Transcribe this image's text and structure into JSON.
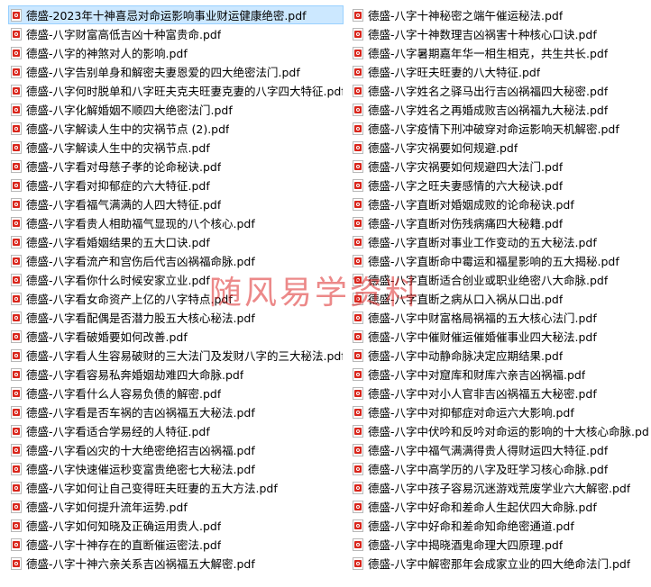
{
  "colors": {
    "pdf_icon": "#d9261c",
    "selection_bg": "#cce8ff",
    "watermark": "#dc2828"
  },
  "watermark": "随风易学资料",
  "files_left": [
    "德盛-2023年十神喜忌对命运影响事业财运健康绝密.pdf",
    "德盛-八字财富高低吉凶十种富贵命.pdf",
    "德盛-八字的神煞对人的影响.pdf",
    "德盛-八字告别单身和解密夫妻恩爱的四大绝密法门.pdf",
    "德盛-八字何时脱单和八字旺夫克夫旺妻克妻的八字四大特征.pdf",
    "德盛-八字化解婚姻不顺四大绝密法门.pdf",
    "德盛-八字解读人生中的灾祸节点 (2).pdf",
    "德盛-八字解读人生中的灾祸节点.pdf",
    "德盛-八字看对母慈子孝的论命秘诀.pdf",
    "德盛-八字看对抑郁症的六大特征.pdf",
    "德盛-八字看福气满满的人四大特征.pdf",
    "德盛-八字看贵人相助福气显现的八个核心.pdf",
    "德盛-八字看婚姻结果的五大口诀.pdf",
    "德盛-八字看流产和宫伤后代吉凶祸福命脉.pdf",
    "德盛-八字看你什么时候安家立业.pdf",
    "德盛-八字看女命资产上亿的八字特点.pdf",
    "德盛-八字看配偶是否潜力股五大核心秘法.pdf",
    "德盛-八字看破婚要如何改善.pdf",
    "德盛-八字看人生容易破财的三大法门及发财八字的三大秘法.pdf",
    "德盛-八字看容易私奔婚姻劫难四大命脉.pdf",
    "德盛-八字看什么人容易负债的解密.pdf",
    "德盛-八字看是否车祸的吉凶祸福五大秘法.pdf",
    "德盛-八字看适合学易经的人特征.pdf",
    "德盛-八字看凶灾的十大绝密绝招吉凶祸福.pdf",
    "德盛-八字快速催运秒变富贵绝密七大秘法.pdf",
    "德盛-八字如何让自己变得旺夫旺妻的五大方法.pdf",
    "德盛-八字如何提升流年运势.pdf",
    "德盛-八字如何知晓及正确运用贵人.pdf",
    "德盛-八字十神存在的直断催运密法.pdf",
    "德盛-八字十神六亲关系吉凶祸福五大解密.pdf"
  ],
  "files_right": [
    "德盛-八字十神秘密之端午催运秘法.pdf",
    "德盛-八字十神数理吉凶祸害十种核心口诀.pdf",
    "德盛-八字暑期嘉年华一相生相克，共生共长.pdf",
    "德盛-八字旺夫旺妻的八大特征.pdf",
    "德盛-八字姓名之驿马出行吉凶祸福四大秘密.pdf",
    "德盛-八字姓名之再婚成败吉凶祸福九大秘法.pdf",
    "德盛-八字疫情下刑冲破穿对命运影响天机解密.pdf",
    "德盛-八字灾祸要如何规避.pdf",
    "德盛-八字灾祸要如何规避四大法门.pdf",
    "德盛-八字之旺夫妻感情的六大秘诀.pdf",
    "德盛-八字直断对婚姻成败的论命秘诀.pdf",
    "德盛-八字直断对伤残病痛四大秘籍.pdf",
    "德盛-八字直断对事业工作变动的五大秘法.pdf",
    "德盛-八字直断命中霉运和福星影响的五大揭秘.pdf",
    "德盛-八字直断适合创业或职业绝密八大命脉.pdf",
    "德盛-八字直断之病从口入祸从口出.pdf",
    "德盛-八字中财富格局祸福的五大核心法门.pdf",
    "德盛-八字中催财催运催婚催事业四大秘法.pdf",
    "德盛-八字中动静命脉决定应期结果.pdf",
    "德盛-八字中对窟库和财库六亲吉凶祸福.pdf",
    "德盛-八字中对小人官非吉凶祸福五大秘密.pdf",
    "德盛-八字中对抑郁症对命运六大影响.pdf",
    "德盛-八字中伏吟和反吟对命运的影响的十大核心命脉.pdf",
    "德盛-八字中福气满满得贵人得财运四大特征.pdf",
    "德盛-八字中高学历的八字及旺学习核心命脉.pdf",
    "德盛-八字中孩子容易沉迷游戏荒废学业六大解密.pdf",
    "德盛-八字中好命和差命人生起伏四大命脉.pdf",
    "德盛-八字中好命和差命知命绝密通道.pdf",
    "德盛-八字中揭晓酒鬼命理大四原理.pdf",
    "德盛-八字中解密那年会成家立业的四大绝命法门.pdf"
  ]
}
